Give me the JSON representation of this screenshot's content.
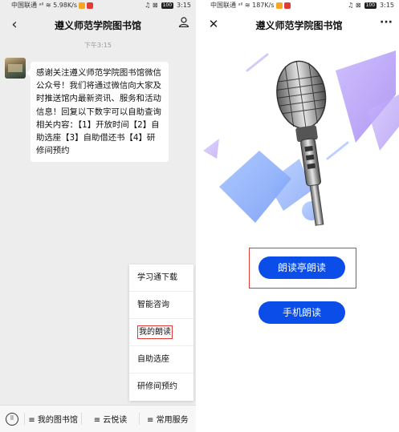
{
  "left": {
    "status": {
      "carrier": "中国联通",
      "speed": "5.98K/s",
      "icons": "♫ ⊠",
      "battery": "100",
      "time": "3:15"
    },
    "nav": {
      "back_icon": "back-chevron-icon",
      "title": "遵义师范学院图书馆",
      "profile_icon": "person-icon"
    },
    "timestamp": "下午3:15",
    "message": "感谢关注遵义师范学院图书馆微信公众号！我们将通过微信向大家及时推送馆内最新资讯、服务和活动信息！回复以下数字可以自助查询相关内容：【1】开放时间【2】自助选座【3】自助借还书【4】研修间预约",
    "menu": [
      "学习通下载",
      "智能咨询",
      "我的朗读",
      "自助选座",
      "研修间预约"
    ],
    "bottom": {
      "keyboard_icon": "keyboard-icon",
      "items": [
        "≡ 我的图书馆",
        "≡ 云悦读",
        "≡ 常用服务"
      ]
    }
  },
  "right": {
    "status": {
      "carrier": "中国联通",
      "speed": "187K/s",
      "icons": "♫ ⊠",
      "battery": "100",
      "time": "3:15"
    },
    "nav": {
      "close_icon": "close-icon",
      "title": "遵义师范学院图书馆",
      "more_icon": "more-dots-icon",
      "more_text": "···"
    },
    "buttons": [
      "朗读亭朗读",
      "手机朗读"
    ],
    "colors": {
      "button_blue": "#0a4de8",
      "highlight_red": "#e53935",
      "accent_purple": "#b9a6f5",
      "accent_blue": "#8fb4ff"
    }
  }
}
